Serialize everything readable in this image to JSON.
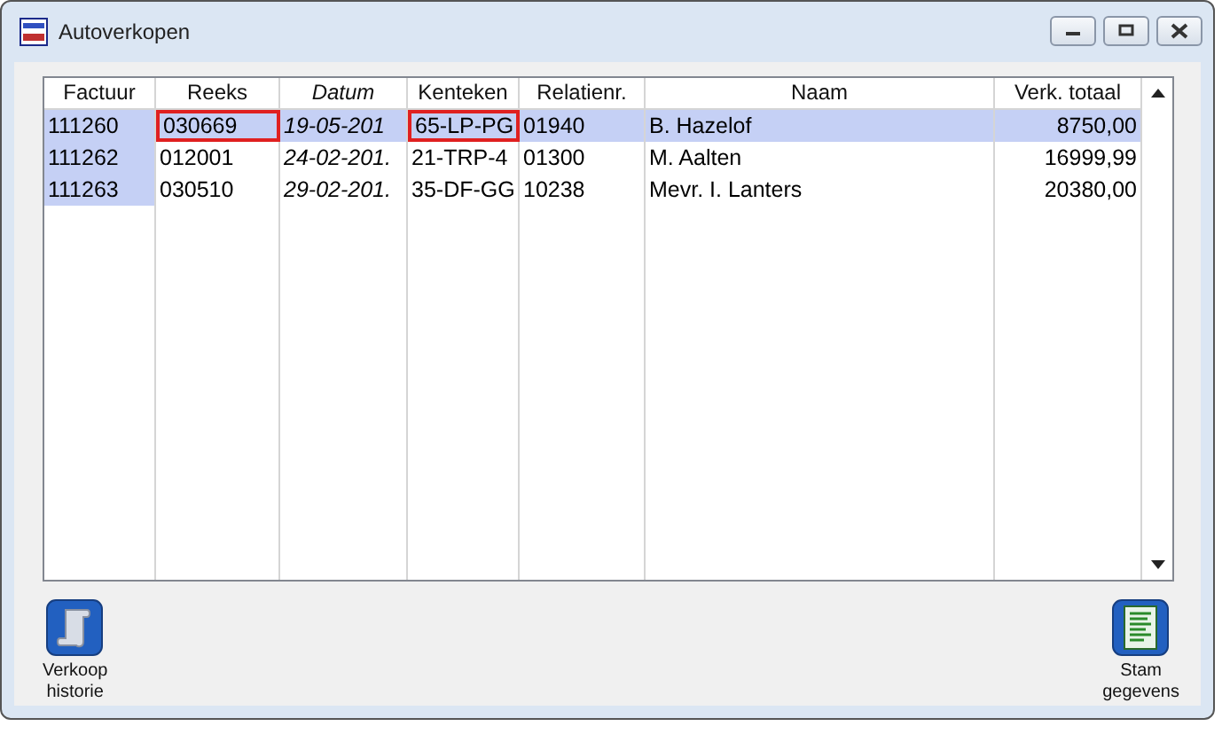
{
  "window": {
    "title": "Autoverkopen"
  },
  "table": {
    "columns": [
      {
        "label": "Factuur",
        "italic": false
      },
      {
        "label": "Reeks",
        "italic": false
      },
      {
        "label": "Datum",
        "italic": true
      },
      {
        "label": "Kenteken",
        "italic": false
      },
      {
        "label": "Relatienr.",
        "italic": false
      },
      {
        "label": "Naam",
        "italic": false
      },
      {
        "label": "Verk. totaal",
        "italic": false
      }
    ],
    "rows": [
      {
        "selected": true,
        "cells": [
          {
            "text": "111260",
            "outlined": false
          },
          {
            "text": "030669",
            "outlined": true
          },
          {
            "text": "19-05-201",
            "outlined": false
          },
          {
            "text": "65-LP-PG",
            "outlined": true
          },
          {
            "text": "01940",
            "outlined": false
          },
          {
            "text": "B. Hazelof",
            "outlined": false
          },
          {
            "text": "8750,00",
            "outlined": false
          }
        ]
      },
      {
        "selected": false,
        "cells": [
          {
            "text": "111262",
            "outlined": false
          },
          {
            "text": "012001",
            "outlined": false
          },
          {
            "text": "24-02-201.",
            "outlined": false
          },
          {
            "text": "21-TRP-4",
            "outlined": false
          },
          {
            "text": "01300",
            "outlined": false
          },
          {
            "text": "M. Aalten",
            "outlined": false
          },
          {
            "text": "16999,99",
            "outlined": false
          }
        ]
      },
      {
        "selected": false,
        "cells": [
          {
            "text": "111263",
            "outlined": false
          },
          {
            "text": "030510",
            "outlined": false
          },
          {
            "text": "29-02-201.",
            "outlined": false
          },
          {
            "text": "35-DF-GG",
            "outlined": false
          },
          {
            "text": "10238",
            "outlined": false
          },
          {
            "text": "Mevr. I. Lanters",
            "outlined": false
          },
          {
            "text": "20380,00",
            "outlined": false
          }
        ]
      }
    ]
  },
  "buttons": [
    {
      "kind": "scroll",
      "line1": "Verkoop",
      "line2": "historie"
    },
    {
      "kind": "list",
      "line1": "Stam",
      "line2": "gegevens"
    }
  ]
}
